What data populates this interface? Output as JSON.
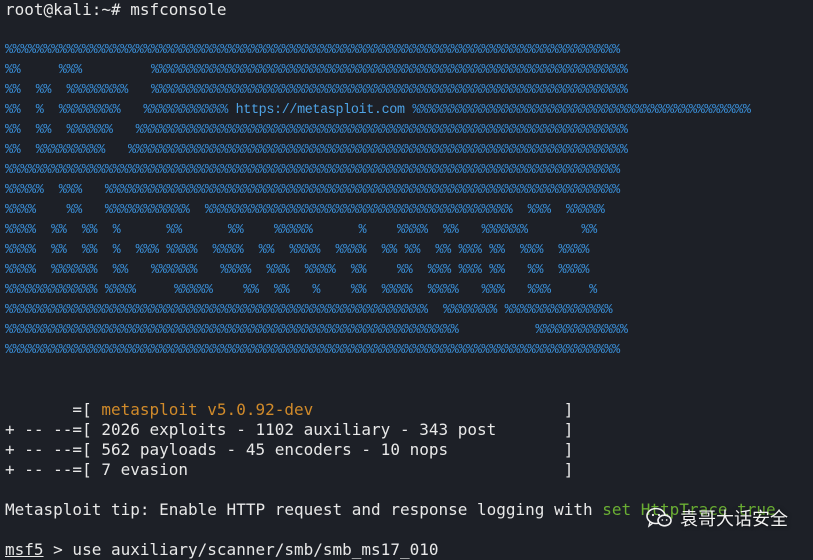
{
  "terminal": {
    "command_prompt": "root@kali:~# msfconsole",
    "banner": {
      "rows": [
        "%%%%%%%%%%%%%%%%%%%%%%%%%%%%%%%%%%%%%%%%%%%%%%%%%%%%%%%%%%%%%%%%%%%%%%%%%%%%%%%%",
        "%%     %%%         %%%%%%%%%%%%%%%%%%%%%%%%%%%%%%%%%%%%%%%%%%%%%%%%%%%%%%%%%%%%%%",
        "%%  %%  %%%%%%%%   %%%%%%%%%%%%%%%%%%%%%%%%%%%%%%%%%%%%%%%%%%%%%%%%%%%%%%%%%%%%%%",
        "%%  %  %%%%%%%%   %%%%%%%%%%% ",
        "%%  %%  %%%%%%   %%%%%%%%%%%%%%%%%%%%%%%%%%%%%%%%%%%%%%%%%%%%%%%%%%%%%%%%%%%%%%%%",
        "%%  %%%%%%%%%   %%%%%%%%%%%%%%%%%%%%%%%%%%%%%%%%%%%%%%%%%%%%%%%%%%%%%%%%%%%%%%%%%",
        "%%%%%%%%%%%%%%%%%%%%%%%%%%%%%%%%%%%%%%%%%%%%%%%%%%%%%%%%%%%%%%%%%%%%%%%%%%%%%%%%",
        "%%%%%  %%%   %%%%%%%%%%%%%%%%%%%%%%%%%%%%%%%%%%%%%%%%%%%%%%%%%%%%%%%%%%%%%%%%%%%",
        "%%%%    %%   %%%%%%%%%%%  %%%%%%%%%%%%%%%%%%%%%%%%%%%%%%%%%%%%%%%%  %%%  %%%%%",
        "%%%%  %%  %%  %      %%      %%    %%%%%      %    %%%%  %%   %%%%%%       %%",
        "%%%%  %%  %%  %  %%% %%%%  %%%%  %%  %%%%  %%%%  %% %%  %% %%% %%  %%%  %%%%",
        "%%%%  %%%%%%  %%   %%%%%%   %%%%  %%%  %%%%  %%    %%  %%% %%% %%   %%  %%%%",
        "%%%%%%%%%%%% %%%%     %%%%%    %%  %%   %    %%  %%%%  %%%%   %%%   %%%     %",
        "%%%%%%%%%%%%%%%%%%%%%%%%%%%%%%%%%%%%%%%%%%%%%%%%%%%%%%%  %%%%%%% %%%%%%%%%%%%%%",
        "%%%%%%%%%%%%%%%%%%%%%%%%%%%%%%%%%%%%%%%%%%%%%%%%%%%%%%%%%%%          %%%%%%%%%%%%",
        "%%%%%%%%%%%%%%%%%%%%%%%%%%%%%%%%%%%%%%%%%%%%%%%%%%%%%%%%%%%%%%%%%%%%%%%%%%%%%%%%"
      ],
      "url": "https://metasploit.com",
      "url_row_tail": " %%%%%%%%%%%%%%%%%%%%%%%%%%%%%%%%%%%%%%%%%%%%"
    },
    "version_line": {
      "prefix": "       =[ ",
      "text": "metasploit v5.0.92-dev",
      "suffix": "                          ]"
    },
    "stats_lines": [
      "+ -- --=[ 2026 exploits - 1102 auxiliary - 343 post       ]",
      "+ -- --=[ 562 payloads - 45 encoders - 10 nops            ]",
      "+ -- --=[ 7 evasion                                       ]"
    ],
    "tip": {
      "text": "Metasploit tip: Enable HTTP request and response logging with ",
      "command": "set HttpTrace true"
    },
    "msf_prompt": {
      "name": "msf5",
      "command": " > use auxiliary/scanner/smb/smb_ms17_010"
    }
  },
  "watermark": {
    "icon": "wechat-icon",
    "text": "袁哥大话安全"
  },
  "colors": {
    "background": "#1d2027",
    "banner": "#3a8fd8",
    "version": "#d08a2a",
    "text": "#e8e8e8",
    "tip_command": "#6aae33"
  }
}
